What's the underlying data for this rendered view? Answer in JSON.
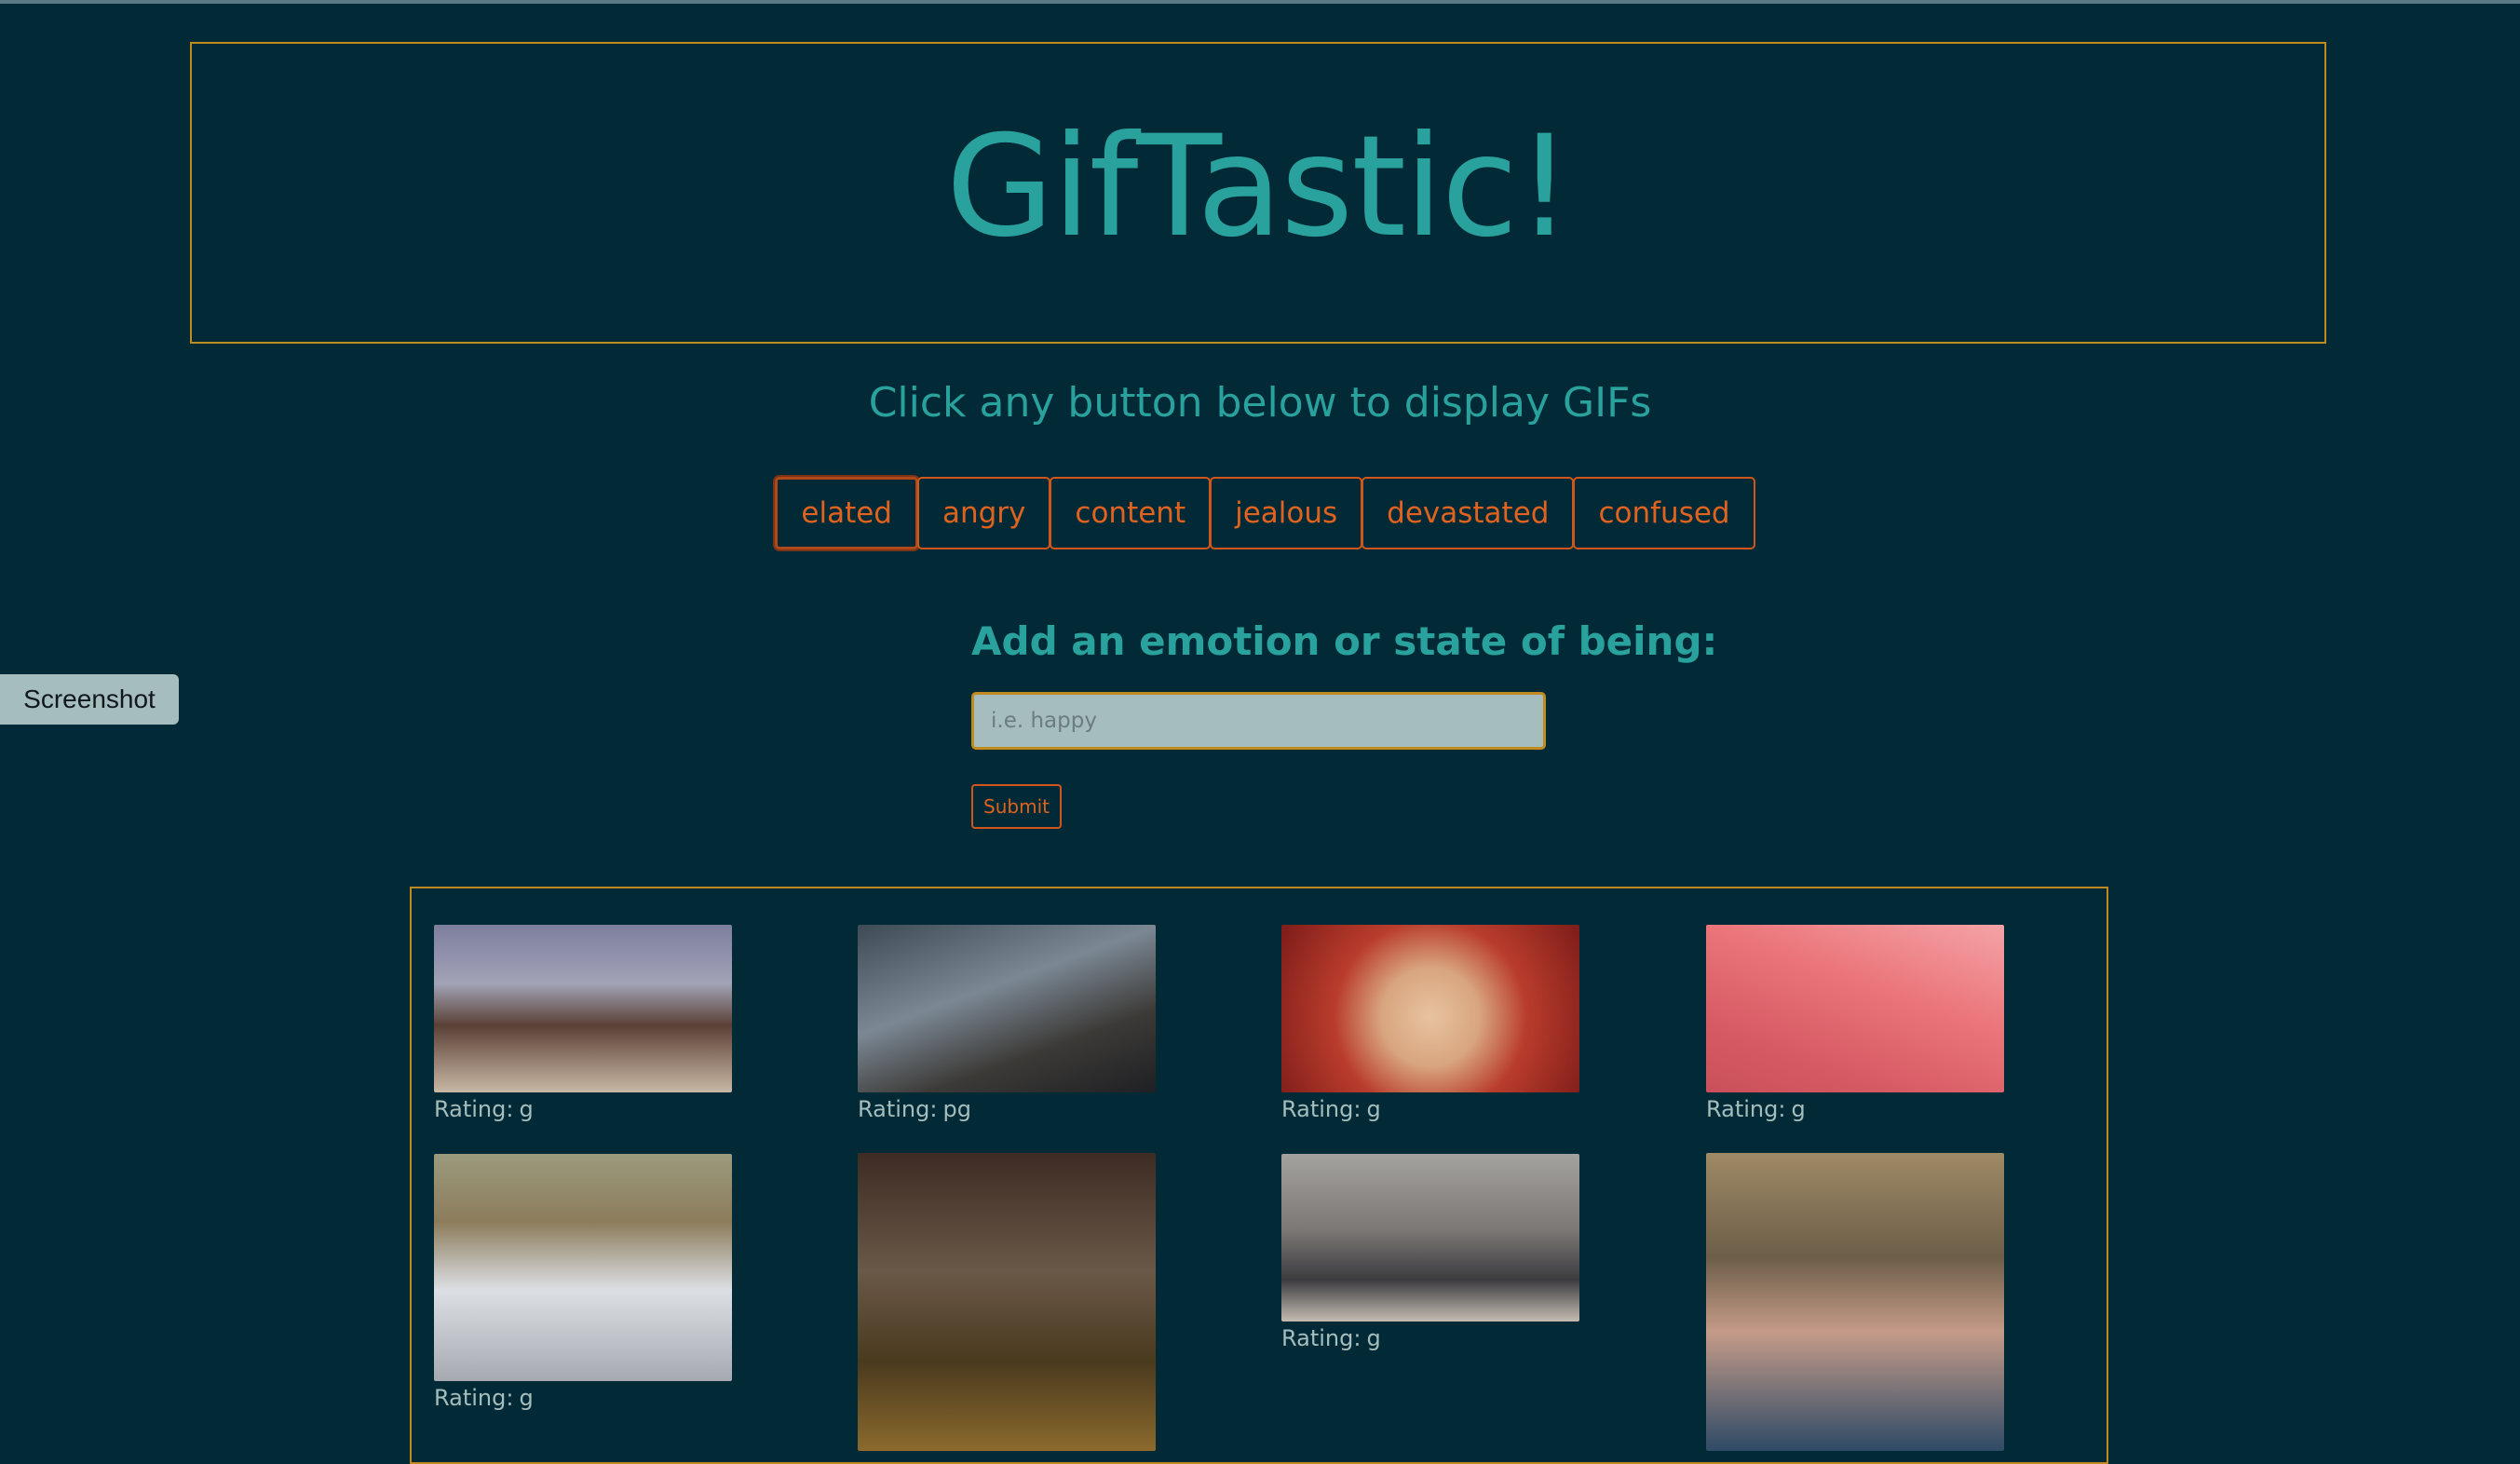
{
  "header": {
    "title": "GifTastic!"
  },
  "instructions": "Click any button below to display GIFs",
  "emotion_buttons": [
    {
      "label": "elated",
      "active": true
    },
    {
      "label": "angry",
      "active": false
    },
    {
      "label": "content",
      "active": false
    },
    {
      "label": "jealous",
      "active": false
    },
    {
      "label": "devastated",
      "active": false
    },
    {
      "label": "confused",
      "active": false
    }
  ],
  "add_form": {
    "label": "Add an emotion or state of being:",
    "input_placeholder": "i.e. happy",
    "input_value": "",
    "submit_label": "Submit"
  },
  "screenshot_tab": "Screenshot",
  "gifs": {
    "rating_prefix": "Rating:",
    "items": [
      {
        "rating": "g"
      },
      {
        "rating": "pg"
      },
      {
        "rating": "g"
      },
      {
        "rating": "g"
      },
      {
        "rating": "g"
      },
      {
        "rating": ""
      },
      {
        "rating": "g"
      },
      {
        "rating": ""
      }
    ]
  },
  "colors": {
    "background": "#012a36",
    "accent_teal": "#29a19c",
    "border_gold": "#c08a1e",
    "button_orange": "#e0621f",
    "input_bg": "#a5bdbc"
  }
}
